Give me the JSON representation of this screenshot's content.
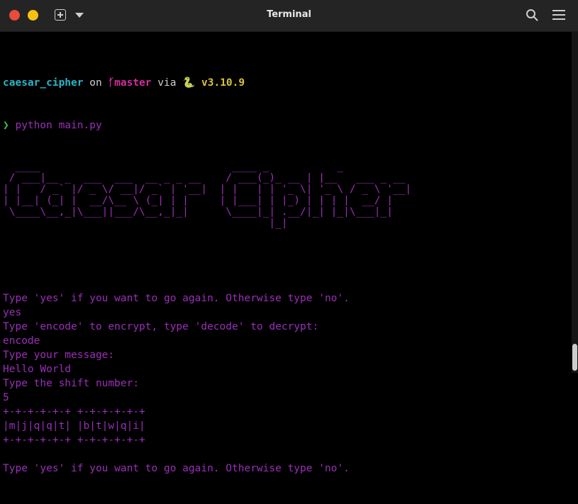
{
  "window": {
    "title": "Terminal"
  },
  "prompt": {
    "directory": "caesar_cipher",
    "on": "on",
    "branch_icon": "ᚶ",
    "branch": "master",
    "via": "via",
    "python_icon": "🐍",
    "version": "v3.10.9",
    "arrow": "❯",
    "command": "python main.py"
  },
  "art": [
    "  ____                               ____ _           _",
    " / ___|__ _  ___  ___  __ _ _ __    / ___(_)_ __ | |__   ___ _ __",
    "| |   / _` |/ _ \\/ __|/ _` | '__|  | |   | | '_ \\| '_ \\ / _ \\ '__|",
    "| |__| (_| |  __/\\__ \\ (_| | |     | |___| | |_) | | | |  __/ |",
    " \\____\\__,_|\\___||___/\\__,_|_|      \\____|_| .__/|_| |_|\\___|_|",
    "                                           |_|"
  ],
  "session": [
    {
      "text": "Type 'yes' if you want to go again. Otherwise type 'no'.",
      "style": "purple"
    },
    {
      "text": "yes",
      "style": "purple"
    },
    {
      "text": "Type 'encode' to encrypt, type 'decode' to decrypt:",
      "style": "purple"
    },
    {
      "text": "encode",
      "style": "purple"
    },
    {
      "text": "Type your message:",
      "style": "purple"
    },
    {
      "text": "Hello World",
      "style": "purple"
    },
    {
      "text": "Type the shift number:",
      "style": "purple"
    },
    {
      "text": "5",
      "style": "purple"
    },
    {
      "text": "+-+-+-+-+-+ +-+-+-+-+-+",
      "style": "purple"
    },
    {
      "text": "|m|j|q|q|t| |b|t|w|q|i|",
      "style": "purple"
    },
    {
      "text": "+-+-+-+-+-+ +-+-+-+-+-+",
      "style": "purple"
    },
    {
      "text": "",
      "style": "purple"
    },
    {
      "text": "Type 'yes' if you want to go again. Otherwise type 'no'.",
      "style": "purple"
    }
  ],
  "colors": {
    "background": "#000000",
    "text_purple": "#9a2fb8",
    "directory": "#2bb6c7",
    "branch": "#d42c9d",
    "version": "#d8c43b",
    "arrow": "#39c449"
  },
  "icons": [
    "new-tab-icon",
    "dropdown-icon",
    "search-icon",
    "hamburger-menu-icon"
  ]
}
